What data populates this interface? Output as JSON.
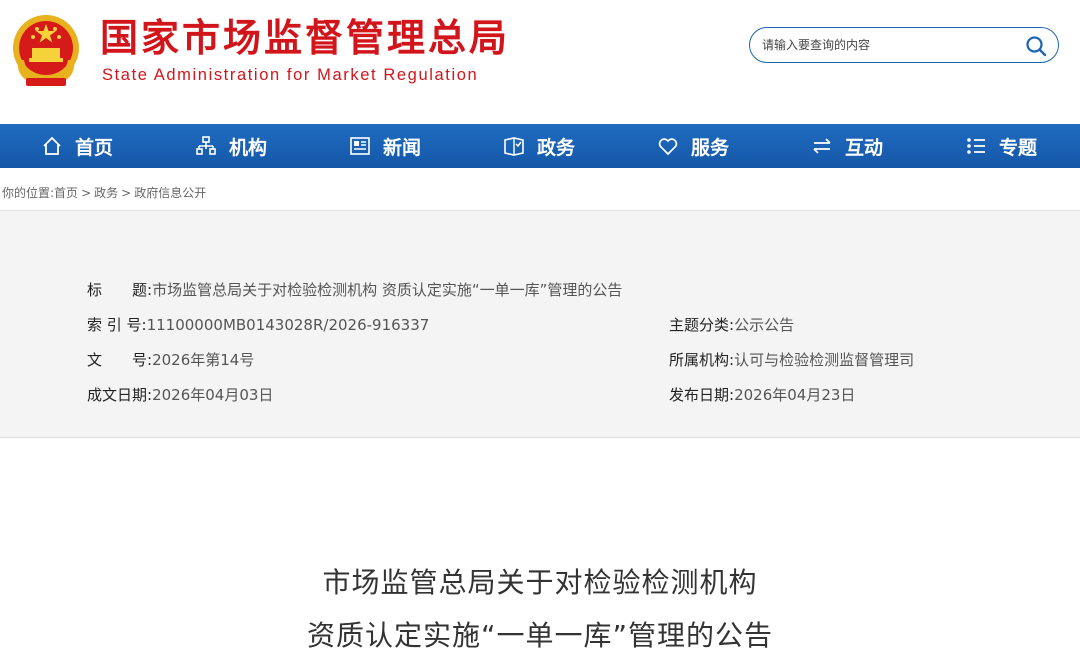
{
  "header": {
    "title": "国家市场监督管理总局",
    "subtitle": "State Administration for Market Regulation",
    "search_placeholder": "请输入要查询的内容"
  },
  "nav": [
    {
      "label": "首页",
      "icon": "home-icon"
    },
    {
      "label": "机构",
      "icon": "org-chart-icon"
    },
    {
      "label": "新闻",
      "icon": "newspaper-icon"
    },
    {
      "label": "政务",
      "icon": "book-icon"
    },
    {
      "label": "服务",
      "icon": "heart-icon"
    },
    {
      "label": "互动",
      "icon": "exchange-arrows-icon"
    },
    {
      "label": "专题",
      "icon": "list-icon"
    }
  ],
  "breadcrumb": {
    "prefix": "你的位置:",
    "items": [
      "首页",
      "政务",
      "政府信息公开"
    ],
    "separator": ">"
  },
  "meta": {
    "title_label": "标　　题:",
    "title_value": "市场监管总局关于对检验检测机构 资质认定实施“一单一库”管理的公告",
    "index_label": "索 引 号:",
    "index_value": "11100000MB0143028R/2026-916337",
    "category_label": "主题分类:",
    "category_value": "公示公告",
    "doc_no_label": "文　　号:",
    "doc_no_value": "2026年第14号",
    "org_label": "所属机构:",
    "org_value": "认可与检验检测监督管理司",
    "written_date_label": "成文日期:",
    "written_date_value": "2026年04月03日",
    "publish_date_label": "发布日期:",
    "publish_date_value": "2026年04月23日"
  },
  "article": {
    "title_line1": "市场监管总局关于对检验检测机构",
    "title_line2": "资质认定实施“一单一库”管理的公告"
  },
  "colors": {
    "brand_red": "#d1151b",
    "nav_blue": "#1a63b5",
    "meta_bg": "#f4f4f4"
  }
}
